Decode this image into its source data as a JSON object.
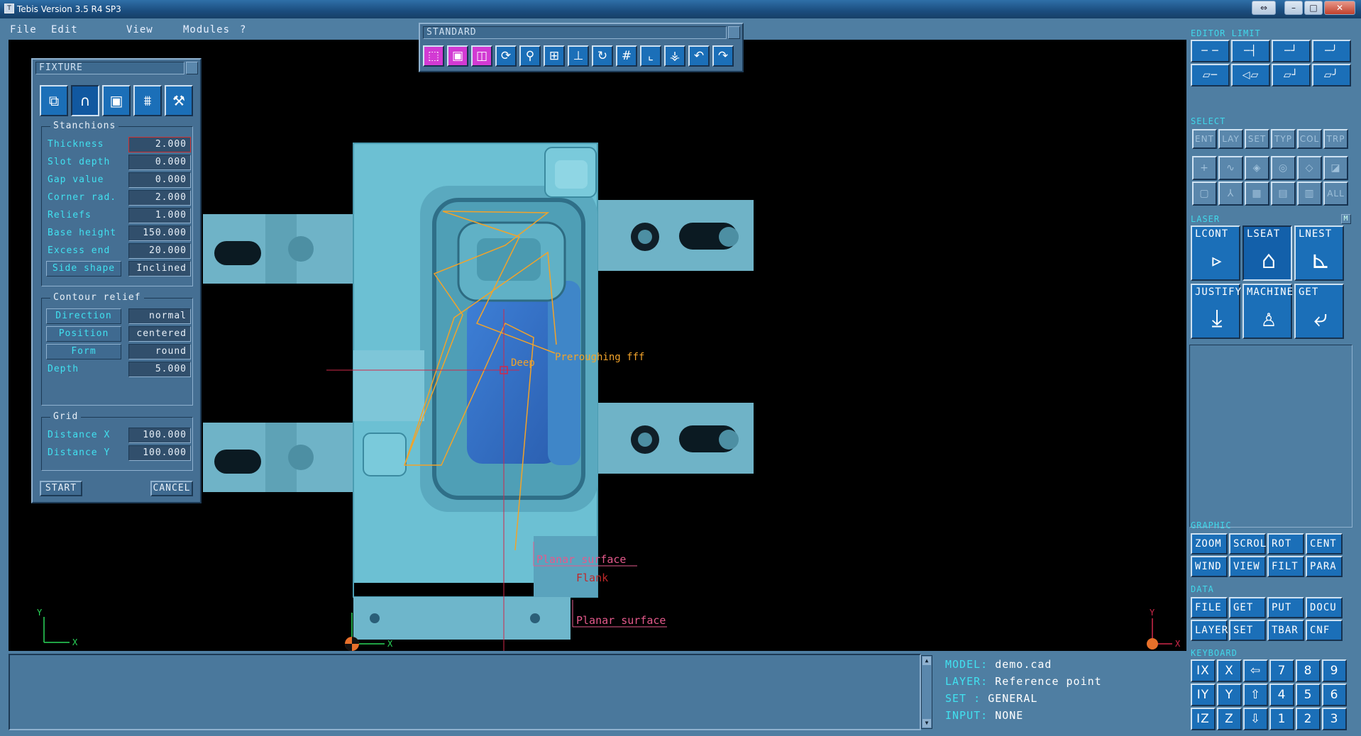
{
  "window": {
    "title": "Tebis Version 3.5 R4 SP3",
    "controls": [
      "⇔",
      "–",
      "□",
      "✕"
    ]
  },
  "menu": [
    "File",
    "Edit",
    "View",
    "Modules",
    "?"
  ],
  "standard_toolbar": {
    "title": "STANDARD",
    "buttons": [
      {
        "icon": "box-wire-icon",
        "glyph": "⬚"
      },
      {
        "icon": "box-shaded-icon",
        "glyph": "▣"
      },
      {
        "icon": "box-front-icon",
        "glyph": "◫"
      },
      {
        "icon": "refresh-icon",
        "glyph": "⟳"
      },
      {
        "icon": "zoom-icon",
        "glyph": "⚲"
      },
      {
        "icon": "fit-icon",
        "glyph": "⊞"
      },
      {
        "icon": "axis-icon",
        "glyph": "⊥"
      },
      {
        "icon": "rotate-icon",
        "glyph": "↻"
      },
      {
        "icon": "grid-icon",
        "glyph": "#"
      },
      {
        "icon": "corner-icon",
        "glyph": "⌞"
      },
      {
        "icon": "origin-icon",
        "glyph": "⚶"
      },
      {
        "icon": "undo-icon",
        "glyph": "↶"
      },
      {
        "icon": "redo-icon",
        "glyph": "↷"
      }
    ]
  },
  "fixture": {
    "title": "FIXTURE",
    "tabs": [
      {
        "icon": "fixture-3d-icon",
        "glyph": "⧉"
      },
      {
        "icon": "stanchion-icon",
        "glyph": "∩"
      },
      {
        "icon": "frame-icon",
        "glyph": "▣"
      },
      {
        "icon": "comb-icon",
        "glyph": "⩩"
      },
      {
        "icon": "wrench-icon",
        "glyph": "⚒"
      }
    ],
    "stanchions": {
      "title": "Stanchions",
      "rows": [
        {
          "label": "Thickness",
          "value": "2.000"
        },
        {
          "label": "Slot depth",
          "value": "0.000"
        },
        {
          "label": "Gap value",
          "value": "0.000"
        },
        {
          "label": "Corner rad.",
          "value": "2.000"
        },
        {
          "label": "Reliefs",
          "value": "1.000"
        },
        {
          "label": "Base height",
          "value": "150.000"
        },
        {
          "label": "Excess end",
          "value": "20.000"
        },
        {
          "label": "Side shape",
          "value": "Inclined"
        }
      ]
    },
    "contour_relief": {
      "title": "Contour relief",
      "rows": [
        {
          "label": "Direction",
          "value": "normal"
        },
        {
          "label": "Position",
          "value": "centered"
        },
        {
          "label": "Form",
          "value": "round"
        },
        {
          "label": "Depth",
          "value": "5.000"
        }
      ]
    },
    "grid": {
      "title": "Grid",
      "rows": [
        {
          "label": "Distance X",
          "value": "100.000"
        },
        {
          "label": "Distance Y",
          "value": "100.000"
        }
      ]
    },
    "start_label": "START",
    "cancel_label": "CANCEL"
  },
  "viewport": {
    "annotations": {
      "deep": "Deep",
      "roughing": "Preroughing fff",
      "flank": "Flank",
      "planar1": "Planar surface",
      "planar2": "Planar surface"
    },
    "axes": {
      "x": "X",
      "y": "Y"
    }
  },
  "right_panel": {
    "editor_title": "EDITOR  LIMIT",
    "select_title": "SELECT",
    "select_buttons": [
      "ENT",
      "LAY",
      "SET",
      "TYP",
      "COL",
      "TRP"
    ],
    "select_all": "ALL",
    "laser_title": "LASER",
    "laser_tag": "M",
    "laser_buttons": [
      "LCONT",
      "LSEAT",
      "LNEST",
      "JUSTIFY",
      "MACHINE",
      "GET"
    ],
    "graphic_title": "GRAPHIC",
    "graphic_buttons": [
      "ZOOM",
      "SCROL",
      "ROT",
      "CENT",
      "WIND",
      "VIEW",
      "FILT",
      "PARA"
    ],
    "data_title": "DATA",
    "data_buttons": [
      "FILE",
      "GET",
      "PUT",
      "DOCU",
      "LAYER",
      "SET",
      "TBAR",
      "CNF"
    ],
    "keyboard_title": "KEYBOARD",
    "keyboard": [
      "IX",
      "X",
      "⇦",
      "7",
      "8",
      "9",
      "IY",
      "Y",
      "⇧",
      "4",
      "5",
      "6",
      "IZ",
      "Z",
      "⇩",
      "1",
      "2",
      "3"
    ]
  },
  "status": {
    "model_key": "MODEL:",
    "model": "demo.cad",
    "layer_key": "LAYER:",
    "layer": "Reference point",
    "set_key": "SET   :",
    "set": "GENERAL",
    "input_key": "INPUT:",
    "input": "NONE"
  }
}
